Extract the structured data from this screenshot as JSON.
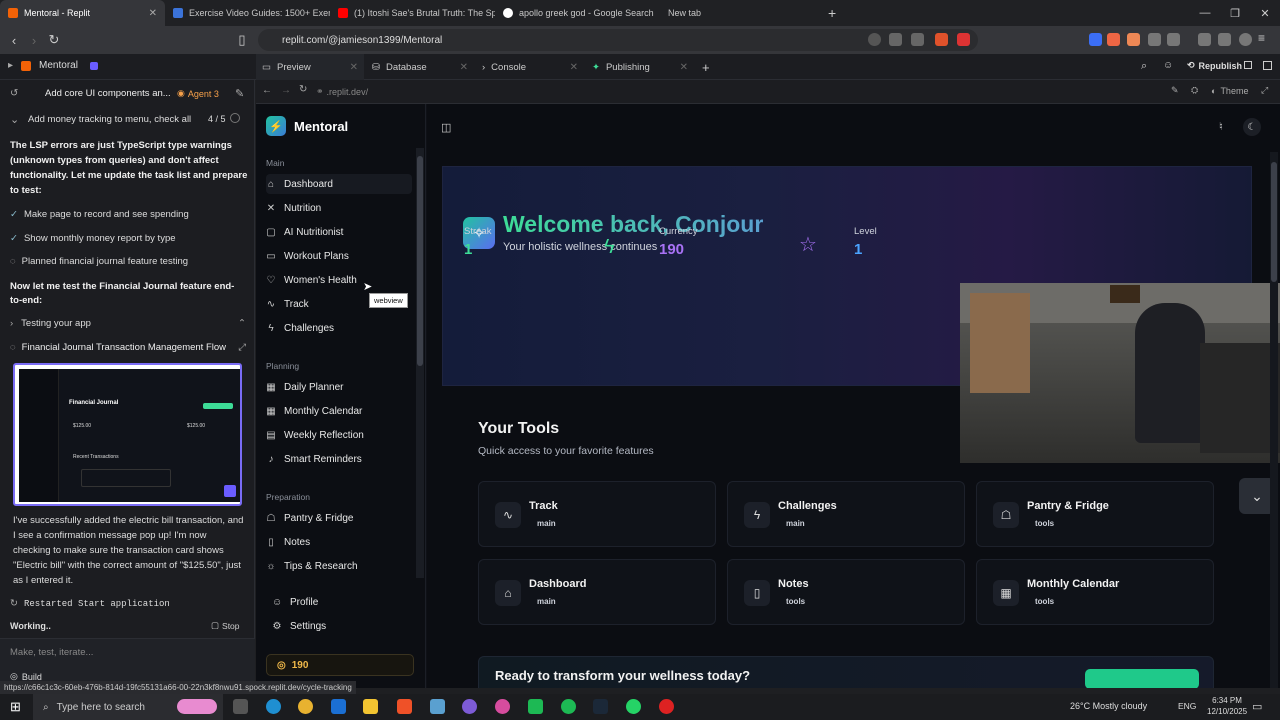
{
  "browser": {
    "tabs": [
      {
        "title": "Mentoral - Replit",
        "color": "#f26207"
      },
      {
        "title": "Exercise Video Guides: 1500+ Exercis",
        "color": "#3b73d9"
      },
      {
        "title": "(1) Itoshi Sae's Brutal Truth: The Spec",
        "color": "#ff0000"
      },
      {
        "title": "apollo greek god - Google Search",
        "color": "#ffffff"
      },
      {
        "title": "New tab",
        "color": ""
      }
    ],
    "new_tab": "+",
    "url": "replit.com/@jamieson1399/Mentoral"
  },
  "replit": {
    "project": "Mentoral",
    "tabs": [
      "Preview",
      "Database",
      "Console",
      "Publishing"
    ],
    "republish": "Republish",
    "preview_url": ".replit.dev/",
    "theme": "Theme"
  },
  "agent": {
    "task_title": "Add core UI components an...",
    "agent_badge": "Agent 3",
    "checklist_title": "Add money tracking to menu, check all",
    "progress": "4 / 5",
    "note": "The LSP errors are just TypeScript type warnings (unknown types from queries) and don't affect functionality. Let me update the task list and prepare to test:",
    "items": [
      "Make page to record and see spending",
      "Show monthly money report by type",
      "Planned financial journal feature testing"
    ],
    "test_intro": "Now let me test the Financial Journal feature end-to-end:",
    "testing": "Testing your app",
    "flow": "Financial Journal Transaction Management Flow",
    "result": "I've successfully added the electric bill transaction, and I see a confirmation message pop up! I'm now checking to make sure the transaction card shows \"Electric bill\" with the correct amount of \"$125.50\", just as I entered it.",
    "restarted": "Restarted Start application",
    "working": "Working..",
    "stop": "Stop",
    "input_placeholder": "Make, test, iterate...",
    "build": "Build",
    "thumb": {
      "title": "Financial Journal",
      "amount1": "$125.00",
      "amount2": "$125.00",
      "recent": "Recent Transactions"
    }
  },
  "app": {
    "brand": "Mentoral",
    "sections": {
      "main": "Main",
      "planning": "Planning",
      "preparation": "Preparation"
    },
    "main_items": [
      "Dashboard",
      "Nutrition",
      "AI Nutritionist",
      "Workout Plans",
      "Women's Health",
      "Track",
      "Challenges"
    ],
    "planning_items": [
      "Daily Planner",
      "Monthly Calendar",
      "Weekly Reflection",
      "Smart Reminders"
    ],
    "prep_items": [
      "Pantry & Fridge",
      "Notes",
      "Tips & Research"
    ],
    "bottom_items": [
      "Profile",
      "Settings"
    ],
    "currency_badge": "190",
    "tooltip": "webview",
    "welcome": "Welcome back, Conjour",
    "subtitle": "Your holistic wellness continues",
    "stats": [
      {
        "label": "Streak",
        "value": "1",
        "color": "#3ddc97"
      },
      {
        "label": "Currency",
        "value": "190",
        "color": "#a872f5"
      },
      {
        "label": "Level",
        "value": "1",
        "color": "#4aa3ff"
      }
    ],
    "tools_title": "Your Tools",
    "tools_subtitle": "Quick access to your favorite features",
    "tools": [
      {
        "title": "Track",
        "tag": "main",
        "icon": "activity-icon"
      },
      {
        "title": "Challenges",
        "tag": "main",
        "icon": "bolt-icon"
      },
      {
        "title": "Pantry & Fridge",
        "tag": "tools",
        "icon": "chef-hat-icon"
      },
      {
        "title": "Dashboard",
        "tag": "main",
        "icon": "home-icon"
      },
      {
        "title": "Notes",
        "tag": "tools",
        "icon": "file-icon"
      },
      {
        "title": "Monthly Calendar",
        "tag": "tools",
        "icon": "calendar-icon"
      }
    ],
    "cta": "Ready to transform your wellness today?"
  },
  "status_url": "https://c66c1c3c-60eb-476b-814d-19fc55131a66-00-22n3kf8nwu91.spock.replit.dev/cycle-tracking",
  "taskbar": {
    "search": "Type here to search",
    "weather": "26°C  Mostly cloudy",
    "lang": "ENG",
    "time": "6:34 PM",
    "date": "12/10/2025"
  }
}
